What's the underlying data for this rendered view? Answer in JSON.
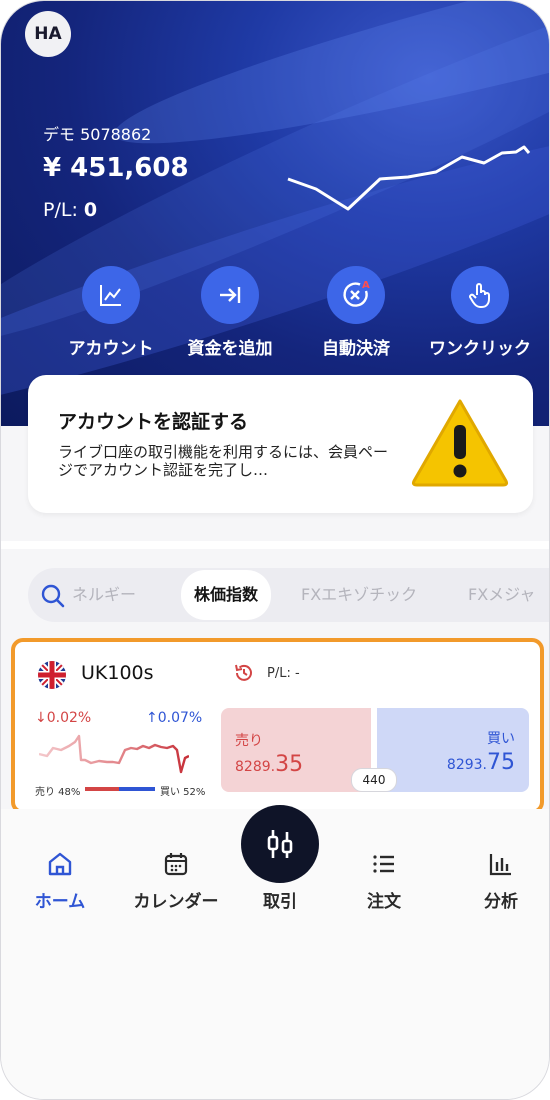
{
  "header": {
    "avatar_initials": "HA",
    "account_label": "デモ 5078862",
    "balance": "¥ 451,608",
    "pl_label": "P/L:",
    "pl_value": "0"
  },
  "actions": [
    {
      "label": "アカウント",
      "icon": "chart-icon"
    },
    {
      "label": "資金を追加",
      "icon": "deposit-arrow-icon"
    },
    {
      "label": "自動決済",
      "icon": "auto-close-icon"
    },
    {
      "label": "ワンクリック",
      "icon": "tap-hand-icon"
    }
  ],
  "verify_card": {
    "title": "アカウントを認証する",
    "description": "ライブ口座の取引機能を利用するには、会員ページでアカウント認証を完了し…",
    "icon": "warning-icon"
  },
  "category_tabs": {
    "items": [
      "エネルギー",
      "株価指数",
      "FXエキゾチック",
      "FXメジャー"
    ],
    "visible_text": [
      "ネルギー",
      "株価指数",
      "FXエキゾチック",
      "FXメジャ"
    ],
    "active": "株価指数"
  },
  "instrument": {
    "symbol": "UK100s",
    "pl_label": "P/L: -",
    "change_down": "↓0.02%",
    "change_up": "↑0.07%",
    "sentiment_sell": "売り 48%",
    "sentiment_buy": "買い 52%",
    "sell_percent": 48,
    "buy_percent": 52,
    "sell_label": "売り",
    "sell_price_main": "8289.",
    "sell_price_big": "35",
    "buy_label": "買い",
    "buy_price_main": "8293.",
    "buy_price_big": "75",
    "spread": "440"
  },
  "bottom_nav": {
    "home": "ホーム",
    "calendar": "カレンダー",
    "trade": "取引",
    "orders": "注文",
    "analysis": "分析"
  },
  "colors": {
    "accent_blue": "#2f55d4",
    "sell_red": "#d34545",
    "highlight_orange": "#f29a2b",
    "hero_navy": "#14257c"
  }
}
